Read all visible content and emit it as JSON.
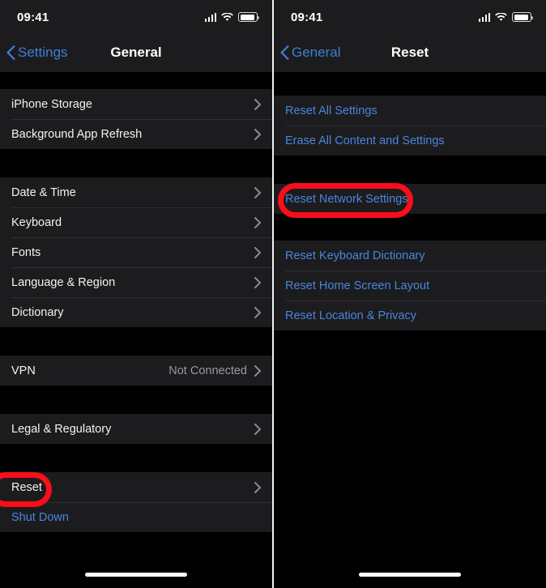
{
  "meta": {
    "accent_blue": "#4a85dd",
    "annotation_red": "#fb0d1b",
    "row_background": "#1c1c1e",
    "page_background": "#000000"
  },
  "left_screen": {
    "status_bar": {
      "time": "09:41",
      "cellular_icon": "cellular-signal-icon",
      "wifi_icon": "wifi-icon",
      "battery_icon": "battery-icon"
    },
    "nav": {
      "back_label": "Settings",
      "back_icon": "chevron-left-icon",
      "title": "General"
    },
    "groups": [
      {
        "rows": [
          {
            "label": "iPhone Storage",
            "value": "",
            "accessory": "chevron-right-icon",
            "style": "default"
          },
          {
            "label": "Background App Refresh",
            "value": "",
            "accessory": "chevron-right-icon",
            "style": "default"
          }
        ]
      },
      {
        "rows": [
          {
            "label": "Date & Time",
            "value": "",
            "accessory": "chevron-right-icon",
            "style": "default"
          },
          {
            "label": "Keyboard",
            "value": "",
            "accessory": "chevron-right-icon",
            "style": "default"
          },
          {
            "label": "Fonts",
            "value": "",
            "accessory": "chevron-right-icon",
            "style": "default"
          },
          {
            "label": "Language & Region",
            "value": "",
            "accessory": "chevron-right-icon",
            "style": "default"
          },
          {
            "label": "Dictionary",
            "value": "",
            "accessory": "chevron-right-icon",
            "style": "default"
          }
        ]
      },
      {
        "rows": [
          {
            "label": "VPN",
            "value": "Not Connected",
            "accessory": "chevron-right-icon",
            "style": "default"
          }
        ]
      },
      {
        "rows": [
          {
            "label": "Legal & Regulatory",
            "value": "",
            "accessory": "chevron-right-icon",
            "style": "default"
          }
        ]
      },
      {
        "rows": [
          {
            "label": "Reset",
            "value": "",
            "accessory": "chevron-right-icon",
            "style": "default"
          },
          {
            "label": "Shut Down",
            "value": "",
            "accessory": "none",
            "style": "blue"
          }
        ]
      }
    ],
    "annotation": {
      "name": "reset-highlight-oval",
      "target_label": "Reset"
    },
    "home_indicator": "home-indicator"
  },
  "right_screen": {
    "status_bar": {
      "time": "09:41",
      "cellular_icon": "cellular-signal-icon",
      "wifi_icon": "wifi-icon",
      "battery_icon": "battery-icon"
    },
    "nav": {
      "back_label": "General",
      "back_icon": "chevron-left-icon",
      "title": "Reset"
    },
    "groups": [
      {
        "rows": [
          {
            "label": "Reset All Settings",
            "value": "",
            "accessory": "none",
            "style": "blue"
          },
          {
            "label": "Erase All Content and Settings",
            "value": "",
            "accessory": "none",
            "style": "blue"
          }
        ]
      },
      {
        "rows": [
          {
            "label": "Reset Network Settings",
            "value": "",
            "accessory": "none",
            "style": "blue"
          }
        ]
      },
      {
        "rows": [
          {
            "label": "Reset Keyboard Dictionary",
            "value": "",
            "accessory": "none",
            "style": "blue"
          },
          {
            "label": "Reset Home Screen Layout",
            "value": "",
            "accessory": "none",
            "style": "blue"
          },
          {
            "label": "Reset Location & Privacy",
            "value": "",
            "accessory": "none",
            "style": "blue"
          }
        ]
      }
    ],
    "annotation": {
      "name": "reset-network-settings-highlight-oval",
      "target_label": "Reset Network Settings"
    },
    "home_indicator": "home-indicator"
  }
}
